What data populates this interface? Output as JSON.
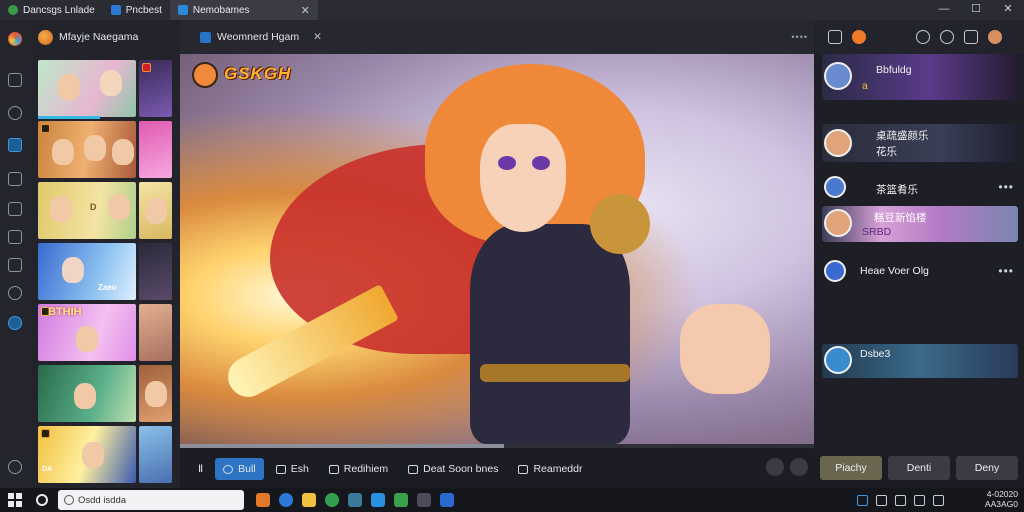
{
  "titlebar": {
    "tabs": [
      {
        "label": "Dancsgs Lnlade"
      },
      {
        "label": "Pncbest"
      },
      {
        "label": "Nemobames"
      }
    ],
    "close_glyph": "✕",
    "window_controls": [
      "—",
      "☐",
      "✕"
    ]
  },
  "left_panel": {
    "title": "Mfayje Naegama",
    "thumb_texts": [
      "D",
      "Zaeo",
      "BTHIH",
      "DA"
    ]
  },
  "viewer": {
    "tab_label": "Weomnerd Hgam",
    "tab_close": "✕",
    "menu_dots": "••••",
    "logo_text": "GSKGH",
    "progress": 0.4
  },
  "toolbar": {
    "buttons": [
      {
        "label": "Ⅱ",
        "icon": "pause-icon"
      },
      {
        "label": "Bull",
        "icon": "play-icon"
      },
      {
        "label": "Esh",
        "icon": "camera-icon"
      },
      {
        "label": "Redihiem",
        "icon": "image-icon"
      },
      {
        "label": "Deat Soon bnes",
        "icon": "flag-icon"
      },
      {
        "label": "Reameddr",
        "icon": "chat-icon"
      }
    ]
  },
  "right_panel": {
    "cards": [
      {
        "title": "Bbfuldg",
        "subtitle": "a"
      },
      {
        "title": "桌疏盛颜乐",
        "subtitle": "花乐"
      },
      {
        "title": "茶篮肴乐",
        "title2": "糕豆新馅楼",
        "subtitle": "SRBD"
      },
      {
        "title": "Heae Voer Olg"
      },
      {
        "title": "Dsbe3"
      }
    ],
    "more_glyph": "•••",
    "buttons": [
      "Piachy",
      "Denti",
      "Deny"
    ]
  },
  "taskbar": {
    "search_text": "Osdd isdda",
    "clock_line1": "4-02020",
    "clock_line2": "AA3AG0"
  },
  "colors": {
    "accent": "#2d74c4",
    "background": "#1c1d24",
    "logo_orange": "#ffb42e"
  }
}
